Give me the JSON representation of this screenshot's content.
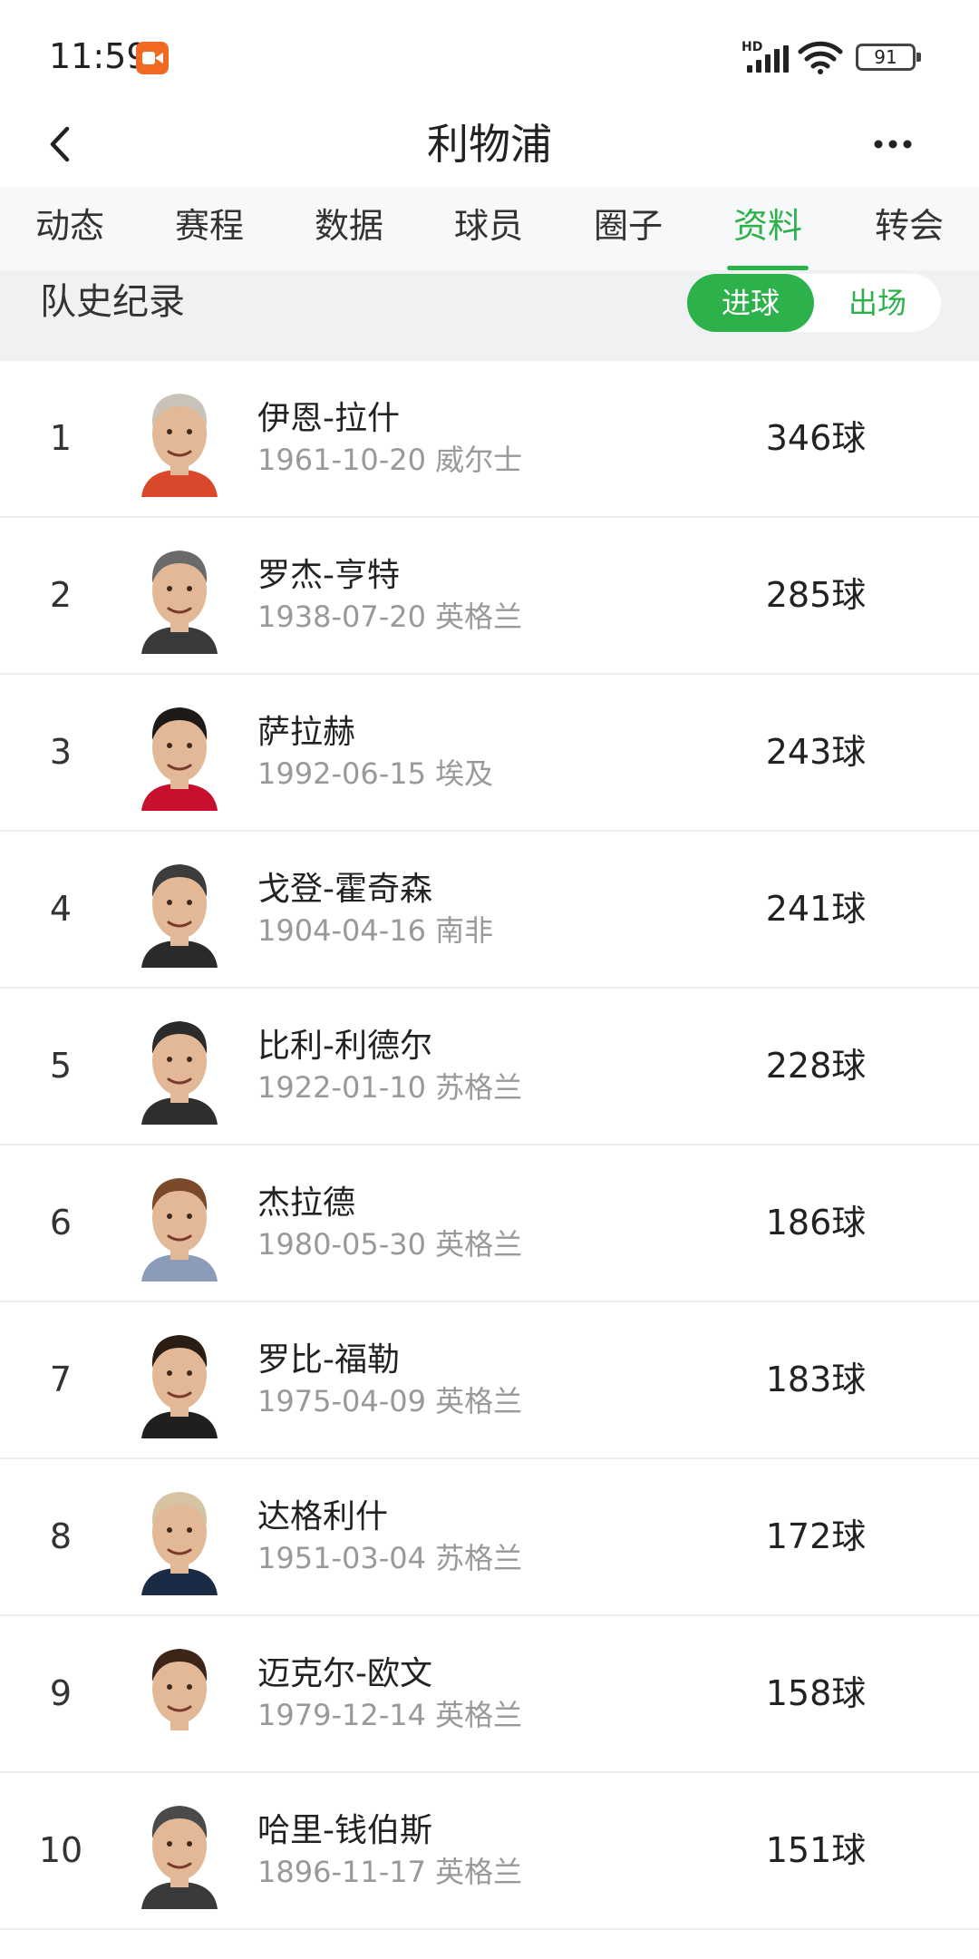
{
  "status_bar": {
    "time": "11:59",
    "network": "HD",
    "battery": "91"
  },
  "header": {
    "title": "利物浦"
  },
  "tabs": [
    {
      "label": "动态",
      "active": false
    },
    {
      "label": "赛程",
      "active": false
    },
    {
      "label": "数据",
      "active": false
    },
    {
      "label": "球员",
      "active": false
    },
    {
      "label": "圈子",
      "active": false
    },
    {
      "label": "资料",
      "active": true
    },
    {
      "label": "转会",
      "active": false
    }
  ],
  "section": {
    "title": "队史纪录",
    "toggle": {
      "selected": "进球",
      "other": "出场"
    }
  },
  "players": [
    {
      "rank": "1",
      "name": "伊恩-拉什",
      "info": "1961-10-20 威尔士",
      "stat": "346球",
      "shirt": "#d9482b",
      "hair": "#c9c2b8"
    },
    {
      "rank": "2",
      "name": "罗杰-亨特",
      "info": "1938-07-20 英格兰",
      "stat": "285球",
      "shirt": "#3a3a3a",
      "hair": "#6a6a6a"
    },
    {
      "rank": "3",
      "name": "萨拉赫",
      "info": "1992-06-15 埃及",
      "stat": "243球",
      "shirt": "#c8102e",
      "hair": "#1d1a18"
    },
    {
      "rank": "4",
      "name": "戈登-霍奇森",
      "info": "1904-04-16 南非",
      "stat": "241球",
      "shirt": "#2a2a2a",
      "hair": "#3c3c3c"
    },
    {
      "rank": "5",
      "name": "比利-利德尔",
      "info": "1922-01-10 苏格兰",
      "stat": "228球",
      "shirt": "#2e2e2e",
      "hair": "#2b2b2b"
    },
    {
      "rank": "6",
      "name": "杰拉德",
      "info": "1980-05-30 英格兰",
      "stat": "186球",
      "shirt": "#8c9bb8",
      "hair": "#7a4a2a"
    },
    {
      "rank": "7",
      "name": "罗比-福勒",
      "info": "1975-04-09 英格兰",
      "stat": "183球",
      "shirt": "#1f1f1f",
      "hair": "#2a1d14"
    },
    {
      "rank": "8",
      "name": "达格利什",
      "info": "1951-03-04 苏格兰",
      "stat": "172球",
      "shirt": "#1b2a45",
      "hair": "#d6c3a2"
    },
    {
      "rank": "9",
      "name": "迈克尔-欧文",
      "info": "1979-12-14 英格兰",
      "stat": "158球",
      "shirt": "#ffffff",
      "hair": "#3b2619"
    },
    {
      "rank": "10",
      "name": "哈里-钱伯斯",
      "info": "1896-11-17 英格兰",
      "stat": "151球",
      "shirt": "#3a3a3a",
      "hair": "#4a4a4a"
    }
  ],
  "colors": {
    "accent": "#2db14a",
    "recording": "#f26a21"
  }
}
